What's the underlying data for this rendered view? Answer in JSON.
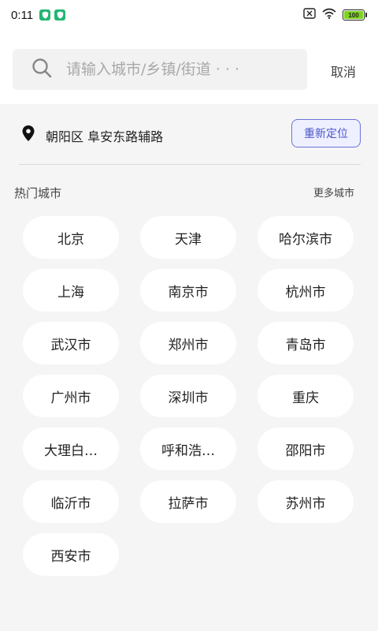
{
  "status_bar": {
    "time": "0:11",
    "battery": "100"
  },
  "search": {
    "placeholder": "请输入城市/乡镇/街道 · · ·",
    "cancel_label": "取消"
  },
  "location": {
    "current": "朝阳区 阜安东路辅路",
    "relocate_label": "重新定位"
  },
  "hot_cities": {
    "title": "热门城市",
    "more_label": "更多城市",
    "items": [
      {
        "label": "北京"
      },
      {
        "label": "天津"
      },
      {
        "label": "哈尔滨市"
      },
      {
        "label": "上海"
      },
      {
        "label": "南京市"
      },
      {
        "label": "杭州市"
      },
      {
        "label": "武汉市"
      },
      {
        "label": "郑州市"
      },
      {
        "label": "青岛市"
      },
      {
        "label": "广州市"
      },
      {
        "label": "深圳市"
      },
      {
        "label": "重庆"
      },
      {
        "label": "大理白…"
      },
      {
        "label": "呼和浩…"
      },
      {
        "label": "邵阳市"
      },
      {
        "label": "临沂市"
      },
      {
        "label": "拉萨市"
      },
      {
        "label": "苏州市"
      },
      {
        "label": "西安市"
      }
    ]
  }
}
